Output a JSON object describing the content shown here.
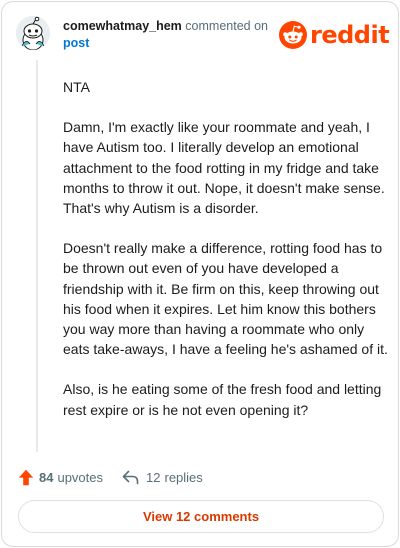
{
  "comment": {
    "author": "comewhatmay_hem",
    "action_text": "commented on",
    "post_link": "post",
    "brand": "reddit",
    "paragraphs": [
      "NTA",
      "Damn, I'm exactly like your roommate and yeah, I have Autism too. I literally develop an emotional attachment to the food rotting in my fridge and take months to throw it out. Nope, it doesn't make sense. That's why Autism is a disorder.",
      "Doesn't really make a difference, rotting food has to be thrown out even of you have developed a friendship with it. Be firm on this, keep throwing out his food when it expires. Let him know this bothers you way more than having a roommate who only eats take-aways, I have a feeling he's ashamed of it.",
      "Also, is he eating some of the fresh food and letting rest expire or is he not even opening it?"
    ]
  },
  "footer": {
    "upvote_count": "84",
    "upvote_word": "upvotes",
    "reply_count": "12",
    "reply_word": "replies",
    "view_comments": "View 12 comments"
  },
  "colors": {
    "brand": "#ff4500",
    "link": "#0079d3",
    "view_comments": "#d93a00",
    "muted": "#576f76"
  },
  "icons": {
    "avatar": "snoo-avatar",
    "logo": "reddit-logo-icon",
    "upvote": "upvote-arrow-icon",
    "reply": "reply-arrow-icon"
  }
}
